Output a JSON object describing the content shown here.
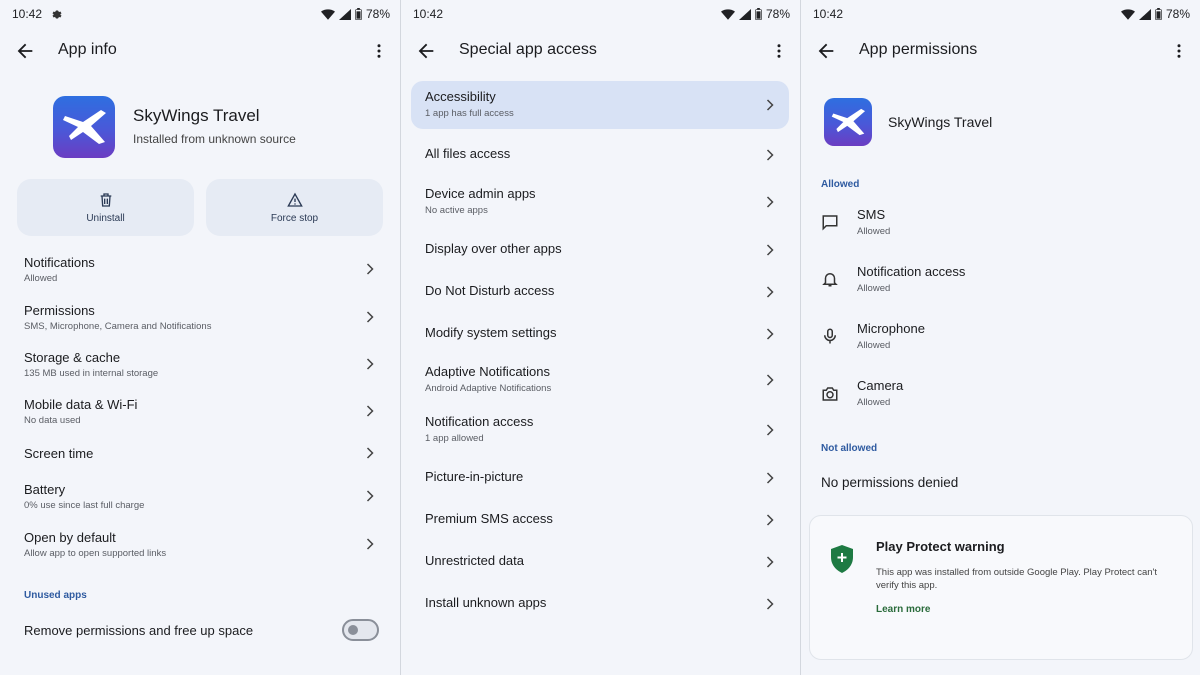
{
  "status_bars": [
    {
      "time": "10:42",
      "battery": "78%"
    },
    {
      "time": "10:42",
      "battery": "78%"
    },
    {
      "time": "10:42",
      "battery": "78%"
    }
  ],
  "app_info": {
    "title": "App info",
    "app_name": "SkyWings Travel",
    "app_source": "Installed from unknown source",
    "actions": [
      {
        "label": "Uninstall",
        "icon": "trash-icon"
      },
      {
        "label": "Force stop",
        "icon": "warning-icon"
      }
    ],
    "rows": [
      {
        "title": "Notifications",
        "subtitle": "Allowed"
      },
      {
        "title": "Permissions",
        "subtitle": "SMS, Microphone, Camera and Notifications"
      },
      {
        "title": "Storage & cache",
        "subtitle": "135 MB used in internal storage"
      },
      {
        "title": "Mobile data & Wi-Fi",
        "subtitle": "No data used"
      },
      {
        "title": "Screen time",
        "subtitle": ""
      },
      {
        "title": "Battery",
        "subtitle": "0% use since last full charge"
      },
      {
        "title": "Open by default",
        "subtitle": "Allow app to open supported links"
      }
    ],
    "unused_section": "Unused apps",
    "unused_toggle_label": "Remove permissions and free up space",
    "unused_toggle_on": false
  },
  "special_access": {
    "title": "Special app access",
    "rows": [
      {
        "title": "Accessibility",
        "subtitle": "1 app has full access",
        "highlighted": true
      },
      {
        "title": "All files access",
        "subtitle": ""
      },
      {
        "title": "Device admin apps",
        "subtitle": "No active apps"
      },
      {
        "title": "Display over other apps",
        "subtitle": ""
      },
      {
        "title": "Do Not Disturb access",
        "subtitle": ""
      },
      {
        "title": "Modify system settings",
        "subtitle": ""
      },
      {
        "title": "Adaptive Notifications",
        "subtitle": "Android Adaptive Notifications"
      },
      {
        "title": "Notification access",
        "subtitle": "1 app allowed"
      },
      {
        "title": "Picture-in-picture",
        "subtitle": ""
      },
      {
        "title": "Premium SMS access",
        "subtitle": ""
      },
      {
        "title": "Unrestricted data",
        "subtitle": ""
      },
      {
        "title": "Install unknown apps",
        "subtitle": ""
      }
    ]
  },
  "app_permissions": {
    "title": "App permissions",
    "app_name": "SkyWings Travel",
    "allowed_label": "Allowed",
    "allowed": [
      {
        "title": "SMS",
        "subtitle": "Allowed",
        "icon": "message-icon"
      },
      {
        "title": "Notification access",
        "subtitle": "Allowed",
        "icon": "bell-icon"
      },
      {
        "title": "Microphone",
        "subtitle": "Allowed",
        "icon": "microphone-icon"
      },
      {
        "title": "Camera",
        "subtitle": "Allowed",
        "icon": "camera-icon"
      }
    ],
    "not_allowed_label": "Not allowed",
    "not_allowed_text": "No permissions denied",
    "warning": {
      "title": "Play Protect warning",
      "body": "This app was installed from outside Google Play. Play Protect can't verify this app.",
      "link": "Learn more"
    }
  },
  "colors": {
    "panel_bg": "#f3f5fa",
    "highlight": "#d8e2f5",
    "section_label": "#2e5aa0",
    "shield": "#1e7a43",
    "link": "#2a6b3b"
  }
}
